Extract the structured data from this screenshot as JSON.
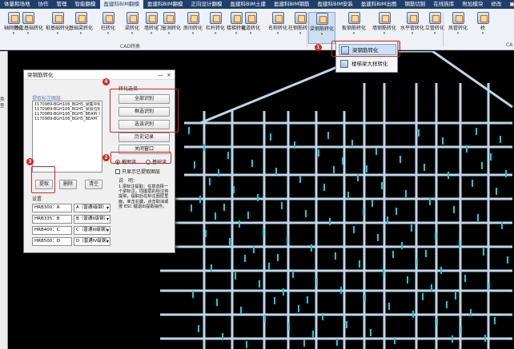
{
  "menubar": {
    "items": [
      "体量和场地",
      "协作",
      "管理",
      "智能翻模",
      "盈建科BIM翻模",
      "盈建科BIM翻模",
      "正向设计翻模",
      "盈建科BIM土建",
      "盈建科BIM钢筋",
      "盈建科BIM安装",
      "盈建科BIM出图",
      "钢筋切割",
      "在线族库",
      "附加模块",
      "修改",
      "▣▾"
    ],
    "active_index": 4
  },
  "ribbon": {
    "buttons": [
      {
        "label": "轴网转化",
        "icon": "axis-grid-icon"
      },
      {
        "label": "独立基础转化",
        "icon": "isolated-foundation-icon"
      },
      {
        "label": "桩基础转化",
        "icon": "pile-foundation-icon"
      },
      {
        "label": "基础梁转化",
        "icon": "foundation-beam-icon"
      },
      {
        "label": "柱转化",
        "icon": "column-icon"
      },
      {
        "label": "梁转化",
        "icon": "beam-icon"
      },
      {
        "label": "墙转化",
        "icon": "wall-icon"
      },
      {
        "label": "门窗洞转化",
        "icon": "door-window-icon"
      },
      {
        "label": "房间转化",
        "icon": "room-icon"
      },
      {
        "label": "栏杆转化",
        "icon": "railing-icon"
      },
      {
        "label": "楼梯转化",
        "icon": "stair-icon"
      },
      {
        "label": "坡道转化",
        "icon": "ramp-icon"
      },
      {
        "label": "名称转化",
        "icon": "name-icon"
      },
      {
        "label": "柱钢筋转化",
        "icon": "column-rebar-icon"
      },
      {
        "label": "梁钢筋转化",
        "icon": "beam-rebar-icon"
      },
      {
        "label": "板钢筋转化",
        "icon": "slab-rebar-icon"
      },
      {
        "label": "墙钢筋转化",
        "icon": "wall-rebar-icon"
      },
      {
        "label": "水平管转化",
        "icon": "horizontal-pipe-icon"
      },
      {
        "label": "立管转化",
        "icon": "vertical-pipe-icon"
      },
      {
        "label": "风管转化",
        "icon": "duct-icon"
      },
      {
        "label": "桥",
        "icon": "bridge-icon"
      }
    ],
    "group_cad": "CAD转换",
    "group_right": "CA"
  },
  "dropdown": {
    "items": [
      "梁钢筋转化",
      "楼梯梁大样转化"
    ],
    "selected_index": 0
  },
  "badges": [
    "1",
    "2",
    "3",
    "4"
  ],
  "leftstrip": {
    "label": "类型"
  },
  "dialog": {
    "title": "梁钢筋转化",
    "minimize": "—",
    "close": "×",
    "layer_section": "提取标注图层",
    "layers": [
      "1170989-BGH106_BGH5_梁集中标注",
      "1170989-BGH106_BGH5_梁原位标注",
      "1170989-BGH106_BGH5_BEAM_CON",
      "1170989-BGH106_BGH5_BEAM"
    ],
    "extract_button": "提取",
    "delete_button": "删除",
    "clear_button": "清空",
    "settings_label": "设置",
    "settings": [
      {
        "code": "HRB300：A",
        "grade": "A（普通I级钢）"
      },
      {
        "code": "HRB335：B",
        "grade": "B（普通II级钢）"
      },
      {
        "code": "HRB400：C",
        "grade": "C（普通III级钢）"
      },
      {
        "code": "HRB500：D",
        "grade": "D（普通IV级钢）"
      }
    ],
    "conversion_label": "转化选择",
    "select_all_button": "全部识别",
    "box_select_button": "框选识别",
    "pick_select_button": "选该识别",
    "history_button": "历史记录",
    "close_window_button": "关闭窗口",
    "radio_full": "截图读",
    "radio_base": "基础读",
    "checkbox_only_layer": "只显示已提取图层",
    "explain_label": "说　明：",
    "explain_text": "1.梁标注提取：任意选择一个梁标注，同图层的标注将提取，提取后在标注图层里面，单击右键，点击取消或按 ESC 键退出提取操作。"
  },
  "colors": {
    "accent_red": "#e0211d",
    "cad_beam": "#bcd7e8",
    "cad_text": "#18c9de",
    "cad_bg": "#000000",
    "menubar": "#1f3f6b"
  }
}
